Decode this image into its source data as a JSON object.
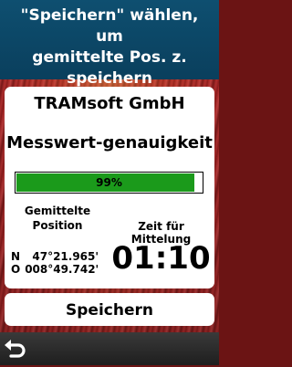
{
  "banner": {
    "line1": "\"Speichern\" wählen, um",
    "line2": "gemittelte Pos. z.",
    "line3": "speichern"
  },
  "card": {
    "company": "TRAMsoft GmbH",
    "accuracy_label": "Messwert-genauigkeit",
    "accuracy_percent": 99,
    "accuracy_text": "99%",
    "position_title_line1": "Gemittelte",
    "position_title_line2": "Position",
    "lat_hemisphere": "N",
    "lat_value": "47°21.965'",
    "lon_hemisphere": "O",
    "lon_value": "008°49.742'",
    "time_title": "Zeit für Mittelung",
    "time_value": "01:10"
  },
  "actions": {
    "save_label": "Speichern"
  },
  "icons": {
    "back": "back-arrow-icon"
  },
  "colors": {
    "banner": "#0e4f70",
    "progress_fill": "#1b9a1b",
    "background": "#a42222"
  }
}
